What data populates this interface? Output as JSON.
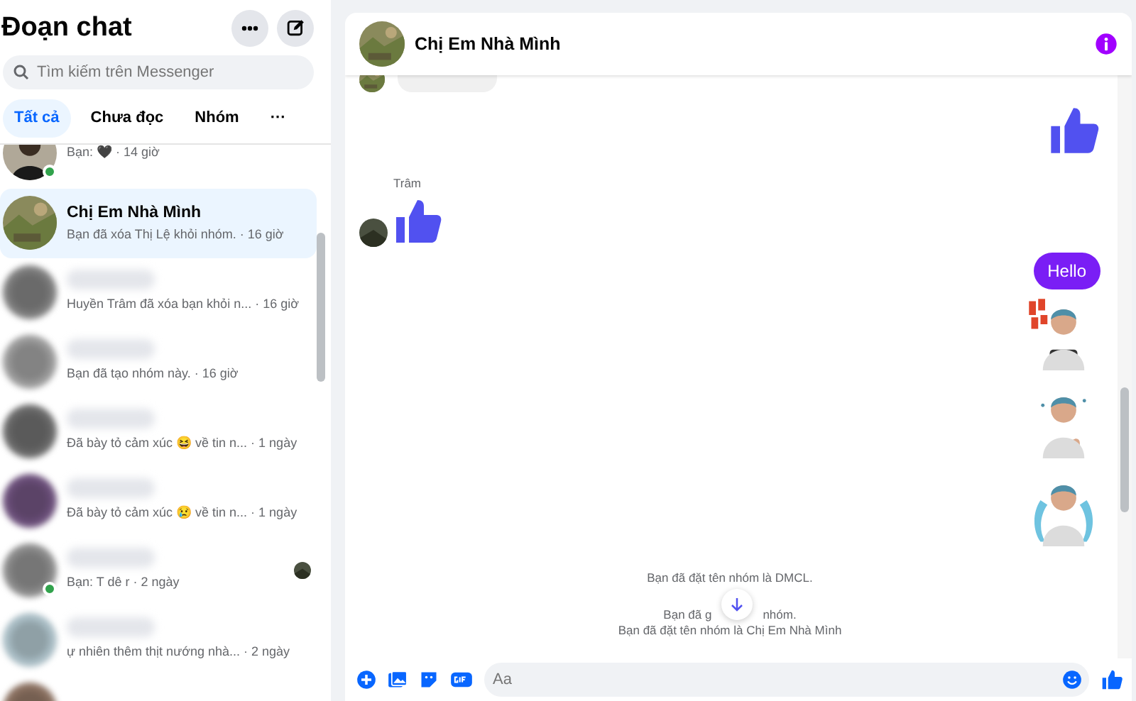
{
  "sidebar": {
    "title": "Đoạn chat",
    "search": {
      "placeholder": "Tìm kiếm trên Messenger"
    },
    "filters": [
      {
        "label": "Tất cả",
        "selected": true
      },
      {
        "label": "Chưa đọc",
        "selected": false
      },
      {
        "label": "Nhóm",
        "selected": false
      },
      {
        "label": "···",
        "selected": false
      }
    ],
    "conversations": [
      {
        "preview": "Bạn: 🖤 · 14 giờ",
        "online": true,
        "selected": false,
        "name_hidden": false,
        "seen": false
      },
      {
        "name": "Chị Em Nhà Mình",
        "preview": "Bạn đã xóa Thị Lệ khỏi nhóm. · 16 giờ",
        "online": false,
        "selected": true,
        "name_hidden": false,
        "seen": false
      },
      {
        "preview": "Huyền Trâm đã xóa bạn khỏi n... · 16 giờ",
        "online": false,
        "selected": false,
        "name_hidden": true,
        "seen": false
      },
      {
        "preview": "Bạn đã tạo nhóm này. · 16 giờ",
        "online": false,
        "selected": false,
        "name_hidden": true,
        "seen": false
      },
      {
        "preview": "Đã bày tỏ cảm xúc 😆 về tin n... · 1 ngày",
        "online": false,
        "selected": false,
        "name_hidden": true,
        "seen": false
      },
      {
        "preview": "Đã bày tỏ cảm xúc 😢 về tin n... · 1 ngày",
        "online": false,
        "selected": false,
        "name_hidden": true,
        "seen": false
      },
      {
        "preview": "Bạn: T dê r · 2 ngày",
        "online": true,
        "selected": false,
        "name_hidden": true,
        "seen": true
      },
      {
        "preview": "ự nhiên thêm thịt nướng nhà... · 2 ngày",
        "online": false,
        "selected": false,
        "name_hidden": true,
        "seen": false
      }
    ]
  },
  "chat": {
    "title": "Chị Em Nhà Mình",
    "messages": [
      {
        "kind": "cut",
        "outgoing": false
      },
      {
        "kind": "like",
        "outgoing": true
      },
      {
        "kind": "like",
        "outgoing": false,
        "sender": "Trâm"
      },
      {
        "kind": "text",
        "outgoing": true,
        "text": "Hello"
      },
      {
        "kind": "sticker",
        "outgoing": true
      },
      {
        "kind": "sticker",
        "outgoing": true
      },
      {
        "kind": "sticker",
        "outgoing": true
      },
      {
        "kind": "system",
        "text": "Bạn đã đặt tên nhóm là DMCL."
      },
      {
        "kind": "system_split",
        "before": "Bạn đã g",
        "after": "nhóm."
      },
      {
        "kind": "system",
        "text": "Bạn đã đặt tên nhóm là Chị Em Nhà Mình"
      }
    ],
    "composer": {
      "placeholder": "Aa"
    }
  }
}
